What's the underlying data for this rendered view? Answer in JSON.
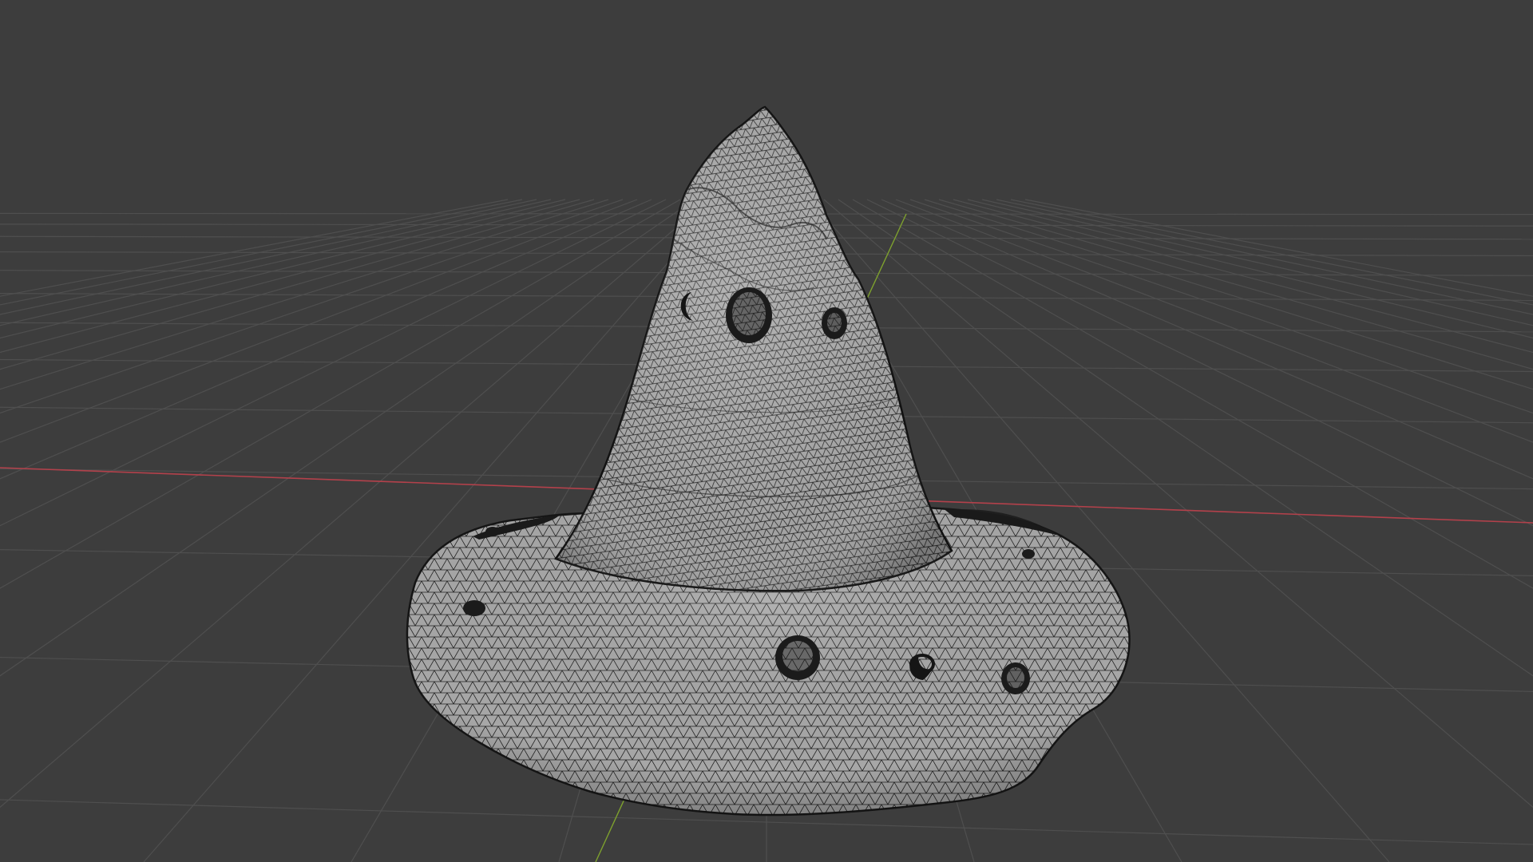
{
  "app": {
    "view": "3D Viewport",
    "shading": "wireframe-over-solid"
  },
  "scene": {
    "object": "witch-hat-mesh",
    "object_color": "#a9a9a9",
    "wire_color": "#1e1e1e",
    "background_color": "#3d3d3d",
    "grid_color": "#4f4f4f",
    "x_axis_color": "#b3414b",
    "y_axis_color": "#7ea12e"
  }
}
